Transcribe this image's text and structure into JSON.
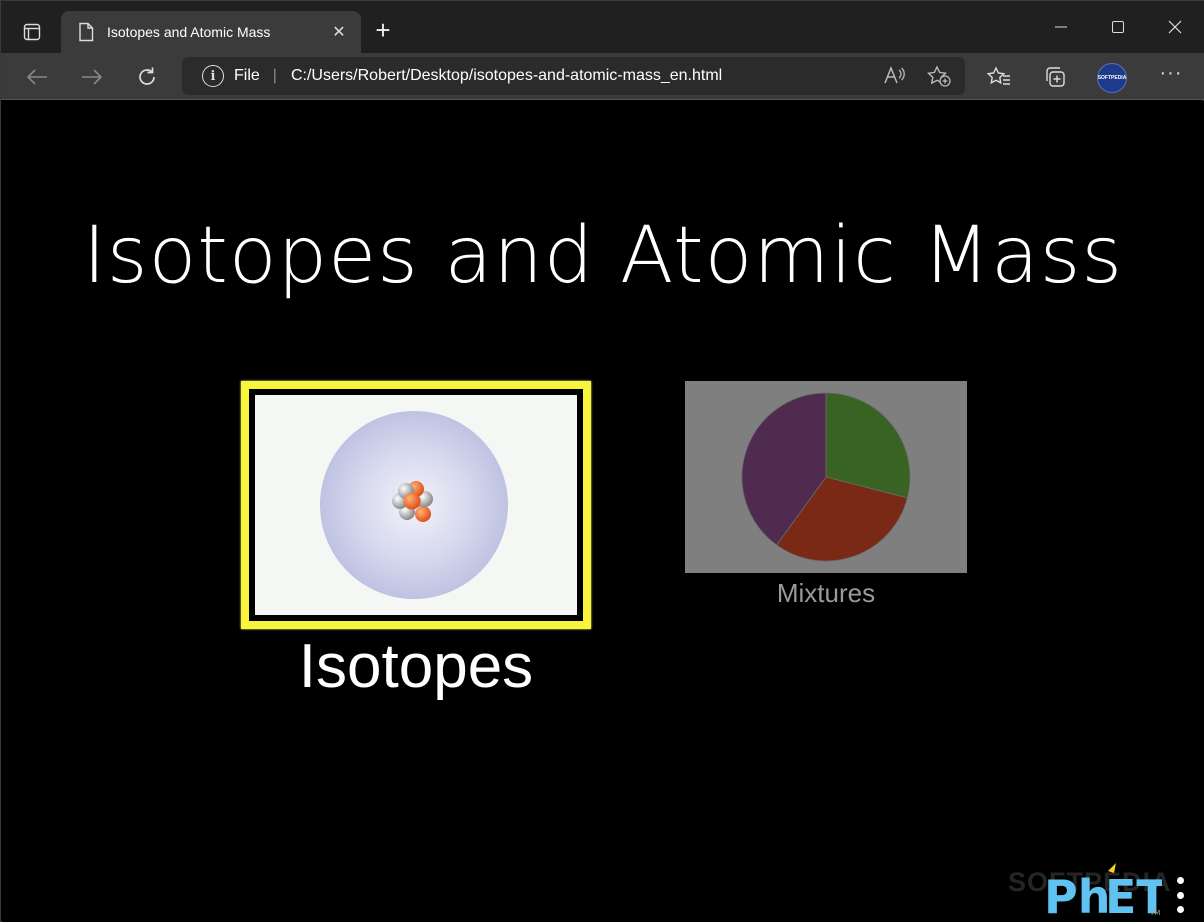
{
  "browser": {
    "tab_title": "Isotopes and Atomic Mass",
    "address": {
      "scheme_label": "File",
      "url": "C:/Users/Robert/Desktop/isotopes-and-atomic-mass_en.html"
    },
    "profile_label": "SOFTPEDIA"
  },
  "sim": {
    "title": "Isotopes and Atomic Mass",
    "screens": [
      {
        "label": "Isotopes",
        "selected": true
      },
      {
        "label": "Mixtures",
        "selected": false
      }
    ],
    "pie": {
      "slices": [
        0.29,
        0.31,
        0.4
      ],
      "colors": [
        "#386322",
        "#7a2916",
        "#4f2b4f"
      ]
    },
    "colors": {
      "highlight": "#f7f43b",
      "background": "#000000"
    },
    "watermark": "SOFTPEDIA"
  }
}
